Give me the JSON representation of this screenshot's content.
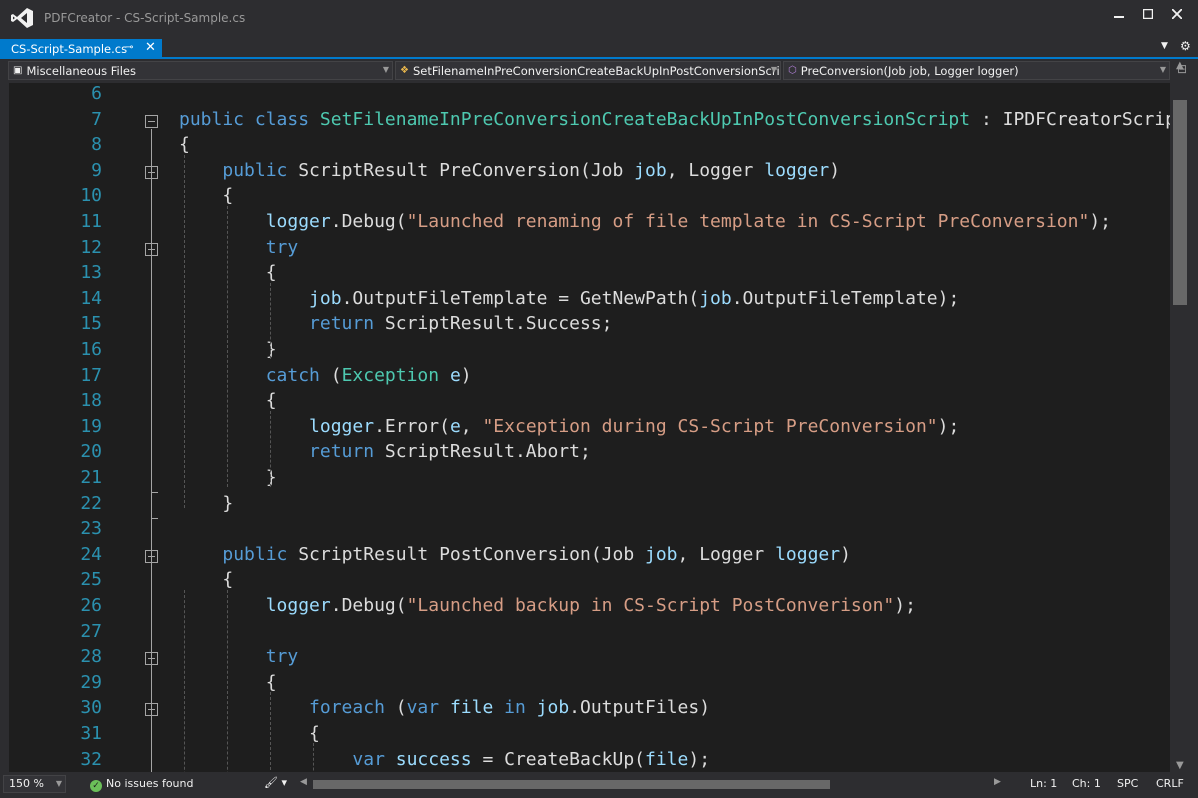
{
  "window": {
    "title": "PDFCreator - CS-Script-Sample.cs"
  },
  "tab": {
    "label": "CS-Script-Sample.cs"
  },
  "nav": {
    "project": "Miscellaneous Files",
    "class": "SetFilenameInPreConversionCreateBackUpInPostConversionScript",
    "member": "PreConversion(Job job, Logger logger)"
  },
  "editor": {
    "lines": [
      {
        "n": "6",
        "tokens": []
      },
      {
        "n": "7",
        "tokens": [
          [
            "kw",
            "public "
          ],
          [
            "kw",
            "class "
          ],
          [
            "ty",
            "SetFilenameInPreConversionCreateBackUpInPostConversionScript"
          ],
          [
            "p",
            " : IPDFCreatorScript"
          ]
        ]
      },
      {
        "n": "8",
        "tokens": [
          [
            "p",
            "{"
          ]
        ]
      },
      {
        "n": "9",
        "tokens": [
          [
            "p",
            "    "
          ],
          [
            "kw",
            "public "
          ],
          [
            "p",
            "ScriptResult PreConversion(Job "
          ],
          [
            "pa",
            "job"
          ],
          [
            "p",
            ", Logger "
          ],
          [
            "pa",
            "logger"
          ],
          [
            "p",
            ")"
          ]
        ]
      },
      {
        "n": "10",
        "tokens": [
          [
            "p",
            "    {"
          ]
        ]
      },
      {
        "n": "11",
        "tokens": [
          [
            "p",
            "        "
          ],
          [
            "pa",
            "logger"
          ],
          [
            "p",
            ".Debug("
          ],
          [
            "st",
            "\"Launched renaming of file template in CS-Script PreConversion\""
          ],
          [
            "p",
            ");"
          ]
        ]
      },
      {
        "n": "12",
        "tokens": [
          [
            "p",
            "        "
          ],
          [
            "kw",
            "try"
          ]
        ]
      },
      {
        "n": "13",
        "tokens": [
          [
            "p",
            "        {"
          ]
        ]
      },
      {
        "n": "14",
        "tokens": [
          [
            "p",
            "            "
          ],
          [
            "pa",
            "job"
          ],
          [
            "p",
            ".OutputFileTemplate = GetNewPath("
          ],
          [
            "pa",
            "job"
          ],
          [
            "p",
            ".OutputFileTemplate);"
          ]
        ]
      },
      {
        "n": "15",
        "tokens": [
          [
            "p",
            "            "
          ],
          [
            "kw",
            "return "
          ],
          [
            "p",
            "ScriptResult.Success;"
          ]
        ]
      },
      {
        "n": "16",
        "tokens": [
          [
            "p",
            "        }"
          ]
        ]
      },
      {
        "n": "17",
        "tokens": [
          [
            "p",
            "        "
          ],
          [
            "kw",
            "catch "
          ],
          [
            "p",
            "("
          ],
          [
            "ty",
            "Exception "
          ],
          [
            "pa",
            "e"
          ],
          [
            "p",
            ")"
          ]
        ]
      },
      {
        "n": "18",
        "tokens": [
          [
            "p",
            "        {"
          ]
        ]
      },
      {
        "n": "19",
        "tokens": [
          [
            "p",
            "            "
          ],
          [
            "pa",
            "logger"
          ],
          [
            "p",
            ".Error("
          ],
          [
            "pa",
            "e"
          ],
          [
            "p",
            ", "
          ],
          [
            "st",
            "\"Exception during CS-Script PreConversion\""
          ],
          [
            "p",
            ");"
          ]
        ]
      },
      {
        "n": "20",
        "tokens": [
          [
            "p",
            "            "
          ],
          [
            "kw",
            "return "
          ],
          [
            "p",
            "ScriptResult.Abort;"
          ]
        ]
      },
      {
        "n": "21",
        "tokens": [
          [
            "p",
            "        }"
          ]
        ]
      },
      {
        "n": "22",
        "tokens": [
          [
            "p",
            "    }"
          ]
        ]
      },
      {
        "n": "23",
        "tokens": []
      },
      {
        "n": "24",
        "tokens": [
          [
            "p",
            "    "
          ],
          [
            "kw",
            "public "
          ],
          [
            "p",
            "ScriptResult PostConversion(Job "
          ],
          [
            "pa",
            "job"
          ],
          [
            "p",
            ", Logger "
          ],
          [
            "pa",
            "logger"
          ],
          [
            "p",
            ")"
          ]
        ]
      },
      {
        "n": "25",
        "tokens": [
          [
            "p",
            "    {"
          ]
        ]
      },
      {
        "n": "26",
        "tokens": [
          [
            "p",
            "        "
          ],
          [
            "pa",
            "logger"
          ],
          [
            "p",
            ".Debug("
          ],
          [
            "st",
            "\"Launched backup in CS-Script PostConverison\""
          ],
          [
            "p",
            ");"
          ]
        ]
      },
      {
        "n": "27",
        "tokens": []
      },
      {
        "n": "28",
        "tokens": [
          [
            "p",
            "        "
          ],
          [
            "kw",
            "try"
          ]
        ]
      },
      {
        "n": "29",
        "tokens": [
          [
            "p",
            "        {"
          ]
        ]
      },
      {
        "n": "30",
        "tokens": [
          [
            "p",
            "            "
          ],
          [
            "kw",
            "foreach "
          ],
          [
            "p",
            "("
          ],
          [
            "kw",
            "var "
          ],
          [
            "pa",
            "file "
          ],
          [
            "kw",
            "in "
          ],
          [
            "pa",
            "job"
          ],
          [
            "p",
            ".OutputFiles)"
          ]
        ]
      },
      {
        "n": "31",
        "tokens": [
          [
            "p",
            "            {"
          ]
        ]
      },
      {
        "n": "32",
        "tokens": [
          [
            "p",
            "                "
          ],
          [
            "kw",
            "var "
          ],
          [
            "pa",
            "success"
          ],
          [
            "p",
            " = CreateBackUp("
          ],
          [
            "pa",
            "file"
          ],
          [
            "p",
            ");"
          ]
        ]
      }
    ]
  },
  "status": {
    "zoom": "150 %",
    "issues": "No issues found",
    "ln": "Ln: 1",
    "ch": "Ch: 1",
    "spc": "SPC",
    "eol": "CRLF"
  }
}
